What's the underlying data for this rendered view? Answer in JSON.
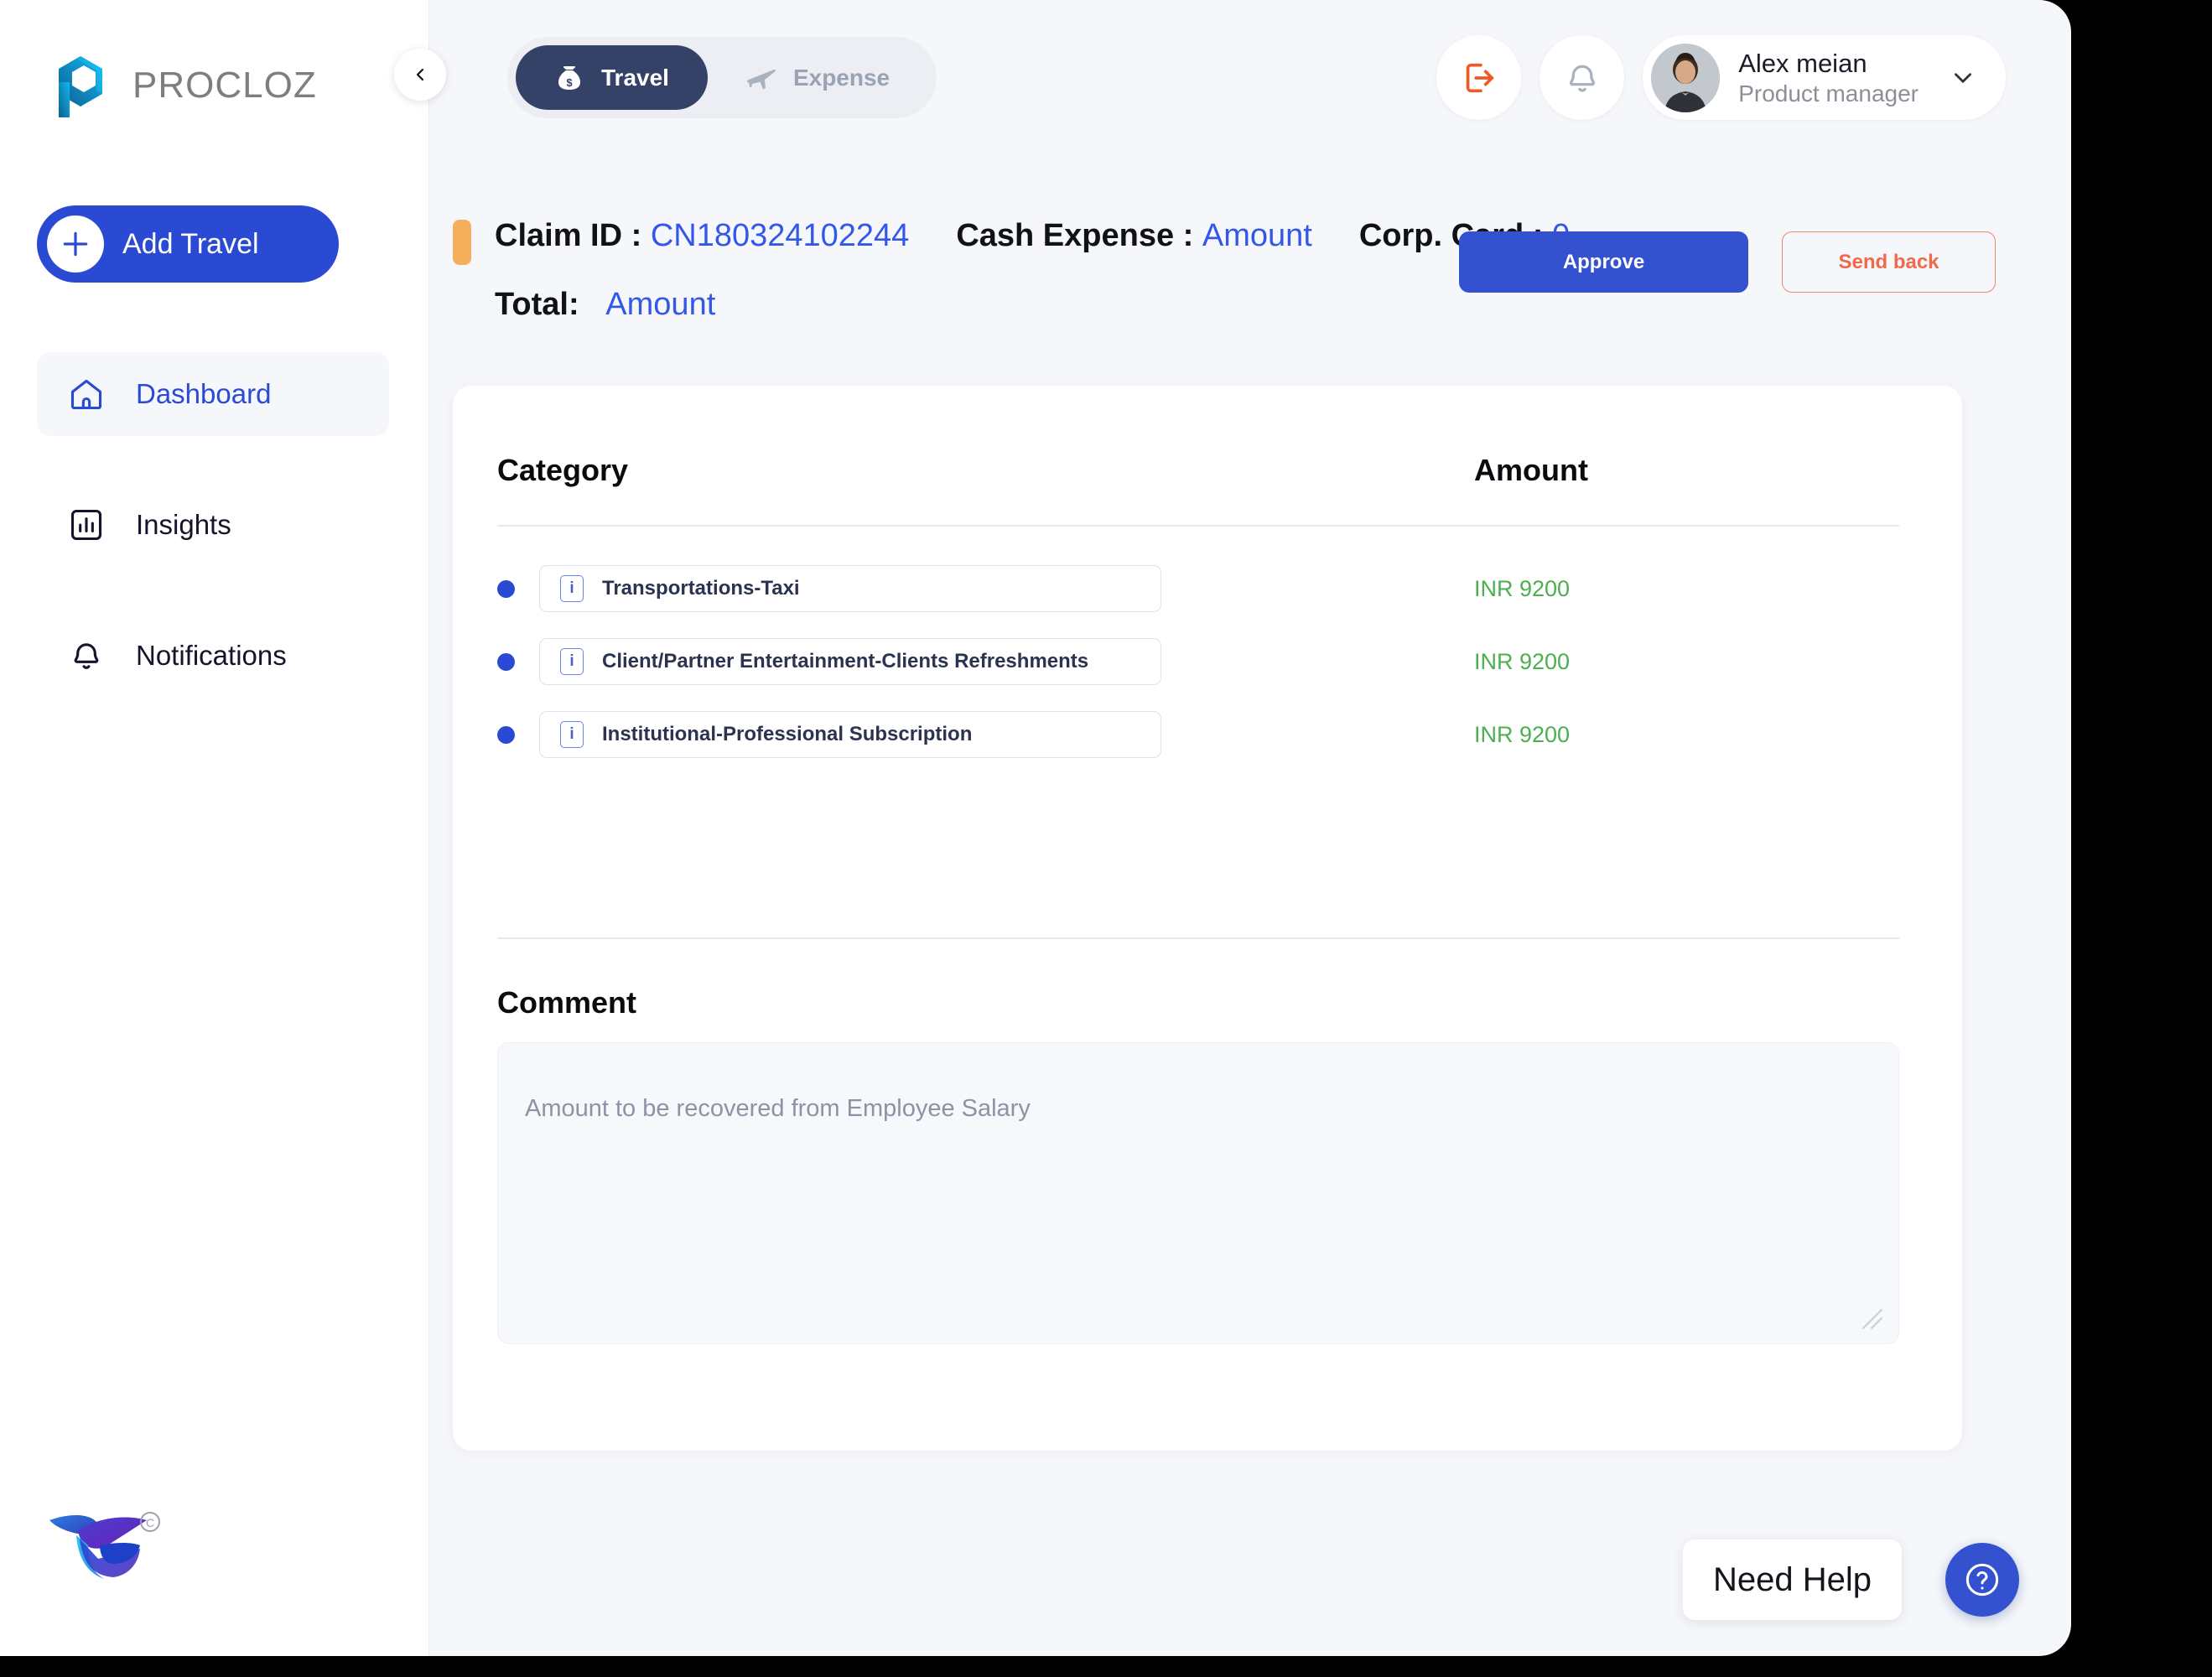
{
  "brand": {
    "name": "PROCLOZ",
    "logo_icon": "procloz-hexagon-logo",
    "footer_logo_icon": "hummingbird-logo",
    "copyright_mark": "©"
  },
  "sidebar": {
    "collapse_icon": "chevron-left-icon",
    "add_button": {
      "label": "Add Travel",
      "icon": "plus-icon"
    },
    "items": [
      {
        "label": "Dashboard",
        "icon": "home-icon",
        "active": true
      },
      {
        "label": "Insights",
        "icon": "bar-chart-icon",
        "active": false
      },
      {
        "label": "Notifications",
        "icon": "bell-icon",
        "active": false
      }
    ]
  },
  "topbar": {
    "tabs": [
      {
        "label": "Travel",
        "icon": "money-bag-icon",
        "active": true
      },
      {
        "label": "Expense",
        "icon": "airplane-icon",
        "active": false
      }
    ],
    "logout_icon": "logout-icon",
    "notification_icon": "bell-outline-icon",
    "user": {
      "name": "Alex meian",
      "role": "Product manager",
      "avatar_icon": "user-avatar-photo",
      "dropdown_icon": "chevron-down-icon"
    }
  },
  "claim": {
    "status_color": "#f5ae5b",
    "claim_id_label": "Claim ID :",
    "claim_id_value": "CN180324102244",
    "cash_expense_label": "Cash Expense :",
    "cash_expense_value": "Amount",
    "corp_card_label": "Corp. Card :",
    "corp_card_value": "0",
    "total_label": "Total:",
    "total_value": "Amount",
    "approve_label": "Approve",
    "send_back_label": "Send back"
  },
  "table": {
    "columns": {
      "category": "Category",
      "amount": "Amount"
    },
    "rows": [
      {
        "category": "Transportations-Taxi",
        "amount": "INR 9200",
        "info_icon": "info-icon"
      },
      {
        "category": "Client/Partner Entertainment-Clients Refreshments",
        "amount": "INR 9200",
        "info_icon": "info-icon"
      },
      {
        "category": "Institutional-Professional Subscription",
        "amount": "INR 9200",
        "info_icon": "info-icon"
      }
    ]
  },
  "comment": {
    "title": "Comment",
    "value": "Amount to be recovered from Employee Salary",
    "resize_icon": "resize-grip-icon"
  },
  "help": {
    "label": "Need Help",
    "fab_icon": "question-mark-icon"
  },
  "colors": {
    "primary_blue": "#2b4ad4",
    "accent_blue": "#3358e8",
    "approve_blue": "#3452d0",
    "send_back_orange": "#f2684a",
    "amount_green": "#4caf50",
    "status_orange": "#f5ae5b",
    "tab_active_navy": "#334266",
    "page_bg": "#f5f7fa"
  }
}
